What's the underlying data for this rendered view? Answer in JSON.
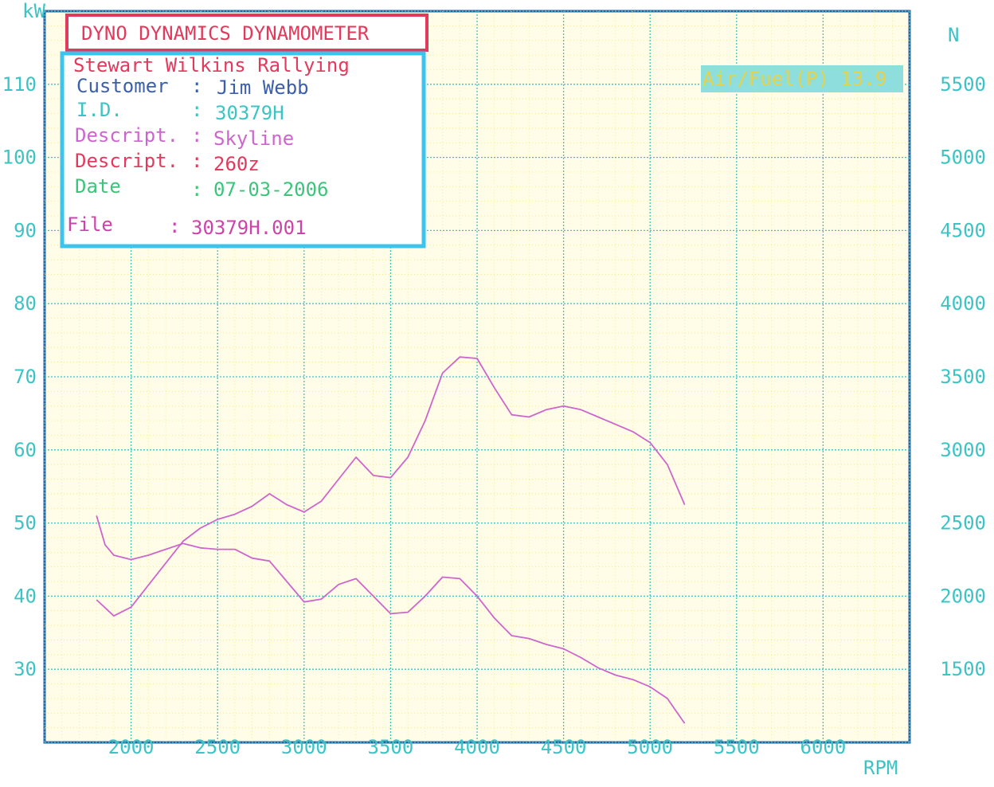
{
  "header": {
    "title": "DYNO DYNAMICS DYNAMOMETER"
  },
  "info": {
    "company": "Stewart Wilkins Rallying",
    "customer_label": "Customer",
    "customer_value": "Jim Webb",
    "id_label": "I.D.",
    "id_value": "30379H",
    "descript1_label": "Descript.",
    "descript1_value": "Skyline",
    "descript2_label": "Descript.",
    "descript2_value": "260z",
    "date_label": "Date",
    "date_value": "07-03-2006",
    "file_label": "File",
    "file_value": "30379H.001"
  },
  "air_fuel": {
    "label": "Air/Fuel(P) 13.9"
  },
  "colors": {
    "grid": "#3cc4c4",
    "curve": "#cc66cc",
    "title_border": "#e23a5c",
    "info_border": "#3cc4ec",
    "plot_border": "#2d5fa3",
    "air_fuel_bg": "#8fdede",
    "air_fuel_text": "#e6d24a",
    "grid_fill": "#fffde8"
  },
  "chart_data": {
    "type": "line",
    "xlabel": "RPM",
    "ylabel_left": "kW",
    "ylabel_right": "N",
    "x_ticks": [
      "2000",
      "2500",
      "3000",
      "3500",
      "4000",
      "4500",
      "5000",
      "5500",
      "6000"
    ],
    "y_left_ticks": [
      "30",
      "40",
      "50",
      "60",
      "70",
      "80",
      "90",
      "100",
      "110"
    ],
    "y_right_ticks": [
      "1500",
      "2000",
      "2500",
      "3000",
      "3500",
      "4000",
      "4500",
      "5000",
      "5500"
    ],
    "xlim": [
      1500,
      6500
    ],
    "ylim_left": [
      20,
      120
    ],
    "ylim_right": [
      1000,
      6000
    ],
    "grid": true,
    "series": [
      {
        "unit_axis": "left",
        "points": [
          [
            1800,
            39.5
          ],
          [
            1900,
            37.3
          ],
          [
            2000,
            38.5
          ],
          [
            2100,
            41.5
          ],
          [
            2200,
            44.5
          ],
          [
            2300,
            47.5
          ],
          [
            2400,
            49.3
          ],
          [
            2500,
            50.5
          ],
          [
            2600,
            51.2
          ],
          [
            2700,
            52.3
          ],
          [
            2800,
            54.0
          ],
          [
            2900,
            52.5
          ],
          [
            3000,
            51.5
          ],
          [
            3100,
            53.0
          ],
          [
            3200,
            56.0
          ],
          [
            3300,
            59.0
          ],
          [
            3400,
            56.5
          ],
          [
            3500,
            56.2
          ],
          [
            3600,
            59.0
          ],
          [
            3700,
            64.0
          ],
          [
            3800,
            70.5
          ],
          [
            3900,
            72.7
          ],
          [
            4000,
            72.5
          ],
          [
            4100,
            68.5
          ],
          [
            4200,
            64.8
          ],
          [
            4300,
            64.5
          ],
          [
            4400,
            65.5
          ],
          [
            4500,
            66.0
          ],
          [
            4600,
            65.5
          ],
          [
            4700,
            64.5
          ],
          [
            4800,
            63.5
          ],
          [
            4900,
            62.5
          ],
          [
            5000,
            61.0
          ],
          [
            5100,
            58.0
          ],
          [
            5200,
            52.5
          ]
        ]
      },
      {
        "unit_axis": "right",
        "points": [
          [
            1800,
            2550
          ],
          [
            1850,
            2350
          ],
          [
            1900,
            2280
          ],
          [
            2000,
            2250
          ],
          [
            2100,
            2280
          ],
          [
            2200,
            2320
          ],
          [
            2300,
            2360
          ],
          [
            2400,
            2330
          ],
          [
            2500,
            2320
          ],
          [
            2600,
            2320
          ],
          [
            2700,
            2260
          ],
          [
            2800,
            2240
          ],
          [
            2900,
            2100
          ],
          [
            3000,
            1960
          ],
          [
            3100,
            1980
          ],
          [
            3200,
            2080
          ],
          [
            3300,
            2120
          ],
          [
            3400,
            2000
          ],
          [
            3500,
            1880
          ],
          [
            3600,
            1890
          ],
          [
            3700,
            2000
          ],
          [
            3800,
            2130
          ],
          [
            3900,
            2120
          ],
          [
            4000,
            2000
          ],
          [
            4100,
            1850
          ],
          [
            4200,
            1730
          ],
          [
            4300,
            1710
          ],
          [
            4400,
            1670
          ],
          [
            4500,
            1640
          ],
          [
            4600,
            1580
          ],
          [
            4700,
            1510
          ],
          [
            4800,
            1460
          ],
          [
            4900,
            1430
          ],
          [
            5000,
            1380
          ],
          [
            5100,
            1300
          ],
          [
            5200,
            1130
          ]
        ]
      }
    ]
  }
}
